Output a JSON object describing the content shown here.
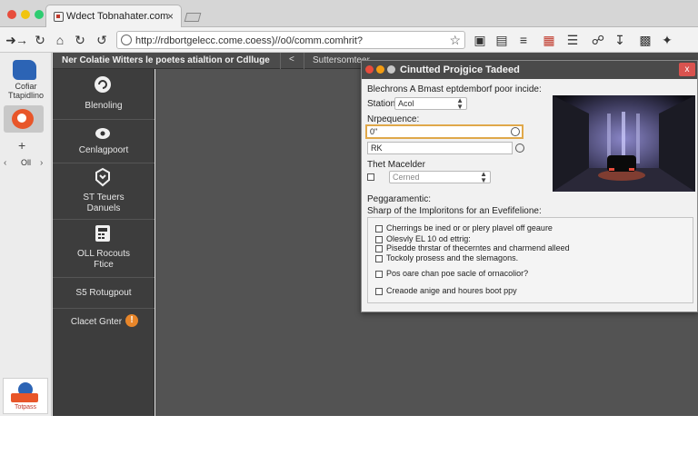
{
  "colors": {
    "accent_orange": "#e8562a",
    "brand_blue": "#2c64b5",
    "dialog_bar": "#4a4a4a",
    "close_red": "#d9534f"
  },
  "tab": {
    "title": "Wdect Tobnahater.com",
    "close": "×"
  },
  "address_bar": {
    "url": "http://rdbortgelecc.come.coess)//o0/comm.comhrit?"
  },
  "left_rail": {
    "app_label": "Cofiar\nTtapidlino",
    "oil_label": "Oll",
    "badge_label": "Totpass"
  },
  "header": {
    "title": "Ner Colatie Witters le poetes atialtion or Cdlluge",
    "back": "<",
    "subtitle": "Suttersomteer"
  },
  "nav": [
    {
      "label": "Blenoling",
      "icon": "refresh-icon"
    },
    {
      "label": "Cenlagpoort",
      "icon": "settings-icon"
    },
    {
      "label": "ST Teuers\nDanuels",
      "icon": "puzzle-icon"
    },
    {
      "label": "OLL Rocouts\nFtice",
      "icon": "calculator-icon"
    },
    {
      "label": "S5 Rotugpout",
      "icon": ""
    },
    {
      "label": "Clacet Gnter",
      "icon": "alert-icon"
    }
  ],
  "dialog": {
    "title": "Cinutted Projgice Tadeed",
    "close": "x",
    "intro": "Blechrons A Bmast eptdemborf poor incide:",
    "station_label": "Station",
    "station_value": "Acol",
    "sequence_label": "Nrpequence:",
    "sequence_value": "0\"",
    "second_value": "RK",
    "mode_label": "Thet Macelder",
    "mode_value": "Cerned",
    "prog_label": "Peggaramentic:",
    "group_label": "Sharp of the Imploritons for an Evefifelione:",
    "options": [
      "Cherrings be ined or or plery plavel off geaure",
      "Olesvly EL 10 od ettrig:",
      "Pisedde thrstar of thecerntes and charmend alleed",
      "Tockoly prosess and the slemagons.",
      "Pos oare chan poe sacle of ornacolior?",
      "Creaode anige and houres boot ppy"
    ]
  }
}
